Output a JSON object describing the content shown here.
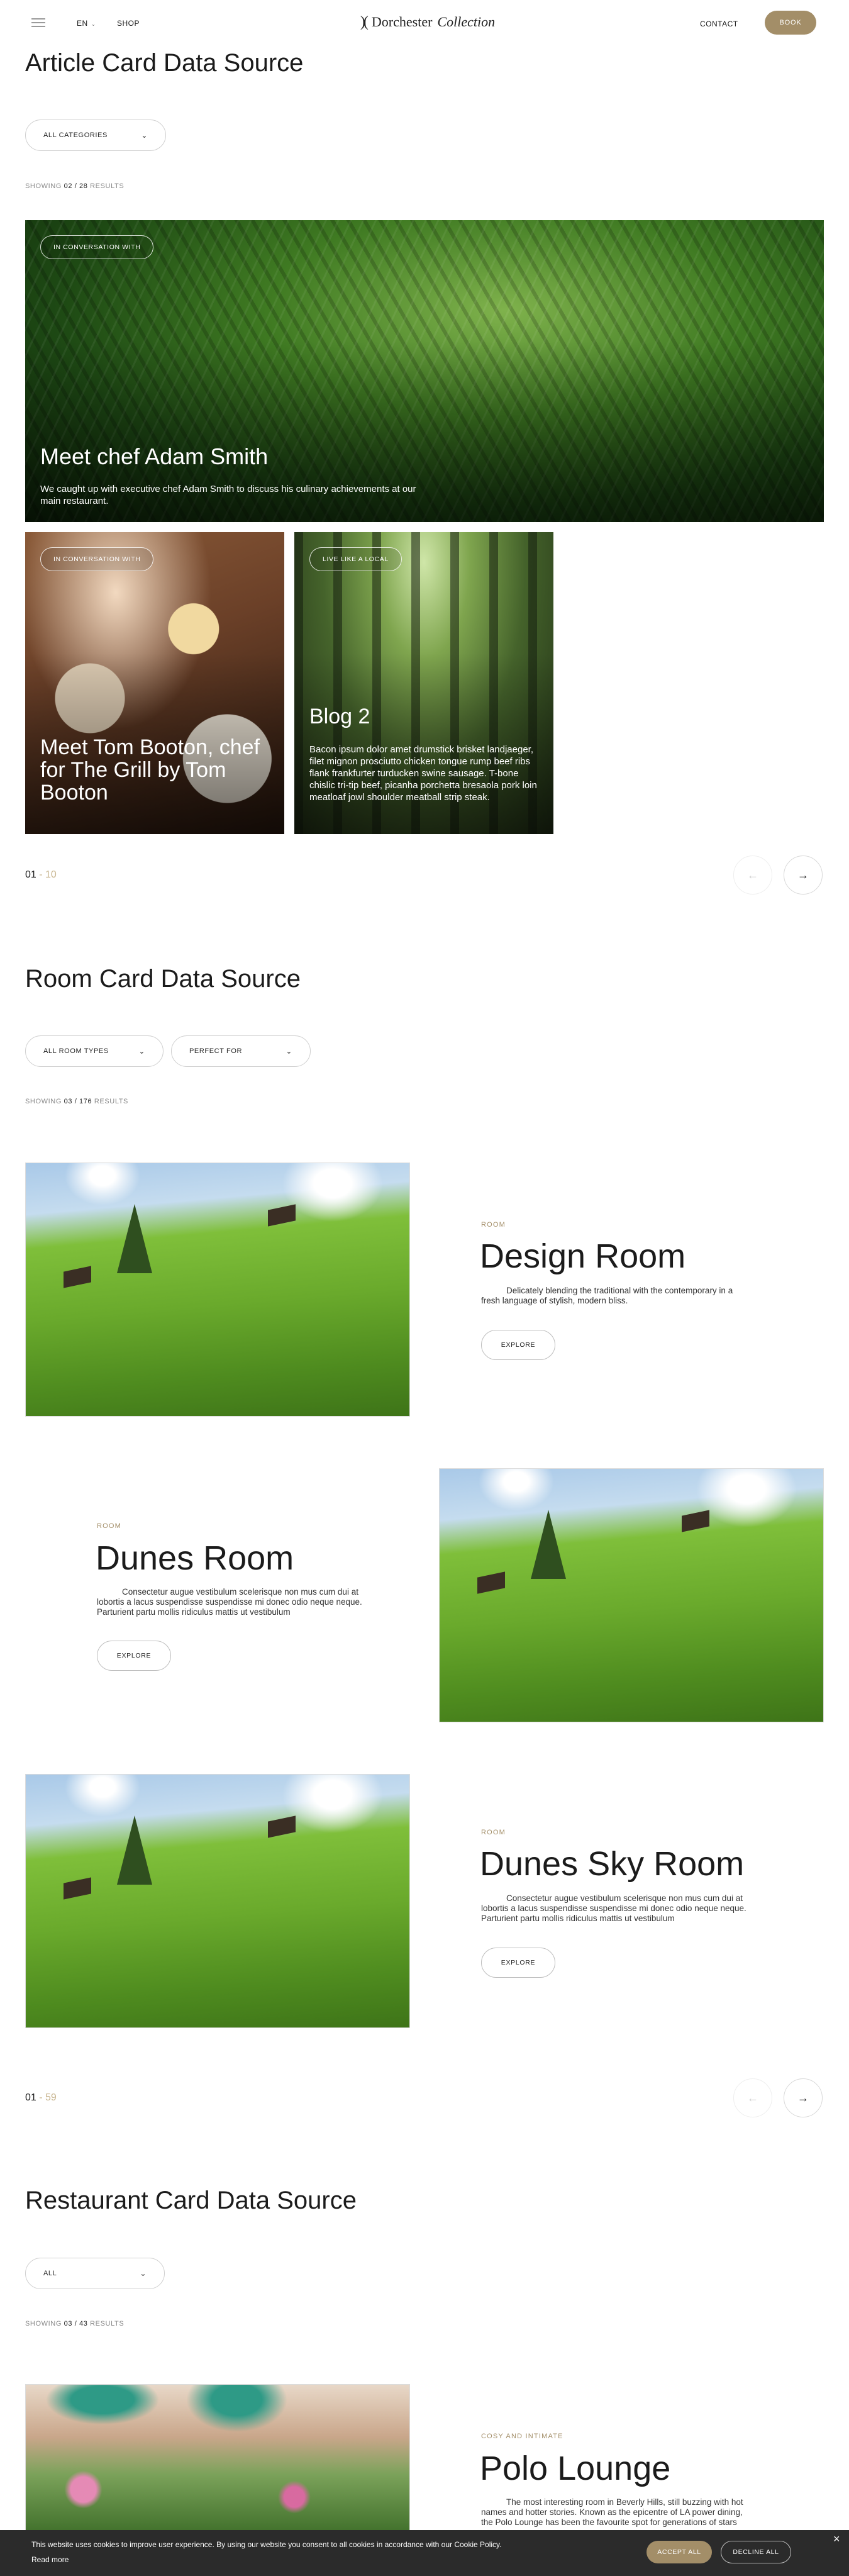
{
  "header": {
    "language": "EN",
    "shop": "SHOP",
    "logo_mark": ")(",
    "logo_name": "Dorchester",
    "logo_script": "Collection",
    "contact": "CONTACT",
    "book": "BOOK"
  },
  "articles": {
    "title": "Article Card Data Source",
    "filter": "ALL CATEGORIES",
    "showing_prefix": "SHOWING",
    "showing_count": "02 / 28",
    "showing_suffix": "RESULTS",
    "cards": [
      {
        "tag": "IN CONVERSATION WITH",
        "title": "Meet chef Adam Smith",
        "description": "We caught up with executive chef Adam Smith to discuss his culinary achievements at our main restaurant."
      },
      {
        "tag": "IN CONVERSATION WITH",
        "title": "Meet Tom Booton, chef for The Grill by Tom Booton",
        "description": ""
      },
      {
        "tag": "LIVE LIKE A LOCAL",
        "title": "Blog 2",
        "description": "Bacon ipsum dolor amet drumstick brisket landjaeger, filet mignon prosciutto chicken tongue rump beef ribs flank frankfurter turducken swine sausage. T-bone chislic tri-tip beef, picanha porchetta bresaola pork loin meatloaf jowl shoulder meatball strip steak."
      }
    ],
    "pager_current": "01",
    "pager_sep": "-",
    "pager_total": "10"
  },
  "rooms": {
    "title": "Room Card Data Source",
    "filter_1": "ALL ROOM TYPES",
    "filter_2": "PERFECT FOR",
    "showing_prefix": "SHOWING",
    "showing_count": "03 / 176",
    "showing_suffix": "RESULTS",
    "items": [
      {
        "category": "ROOM",
        "title": "Design Room",
        "description": "Delicately blending the traditional with the contemporary in a fresh language of stylish, modern bliss.",
        "button": "EXPLORE"
      },
      {
        "category": "ROOM",
        "title": "Dunes Room",
        "description": "Consectetur augue vestibulum scelerisque non mus cum dui at lobortis a lacus suspendisse suspendisse mi donec odio neque neque. Parturient partu mollis ridiculus mattis ut vestibulum",
        "button": "EXPLORE"
      },
      {
        "category": "ROOM",
        "title": "Dunes Sky Room",
        "description": "Consectetur augue vestibulum scelerisque non mus cum dui at lobortis a lacus suspendisse suspendisse mi donec odio neque neque. Parturient partu mollis ridiculus mattis ut vestibulum",
        "button": "EXPLORE"
      }
    ],
    "pager_current": "01",
    "pager_sep": "-",
    "pager_total": "59"
  },
  "restaurants": {
    "title": "Restaurant Card Data Source",
    "filter": "ALL",
    "showing_prefix": "SHOWING",
    "showing_count": "03 / 43",
    "showing_suffix": "RESULTS",
    "items": [
      {
        "category": "COSY AND INTIMATE",
        "title": "Polo Lounge",
        "description": "The most interesting room in Beverly Hills, still buzzing with hot names and hotter stories. Known as the epicentre of LA power dining, the Polo Lounge has been the favourite spot for generations of stars"
      }
    ]
  },
  "cookie": {
    "text": "This website uses cookies to improve user experience. By using our website you consent to all cookies in accordance with our Cookie Policy.",
    "read_more": "Read more",
    "accept": "ACCEPT ALL",
    "decline": "DECLINE ALL",
    "close": "×"
  },
  "icons": {
    "menu": "menu-icon",
    "chevron": "chevron-down-icon",
    "arrow_left": "←",
    "arrow_right": "→"
  },
  "colors": {
    "accent": "#a38e68",
    "text": "#1b1b1b",
    "cookie_bg": "#2b2b2b"
  }
}
